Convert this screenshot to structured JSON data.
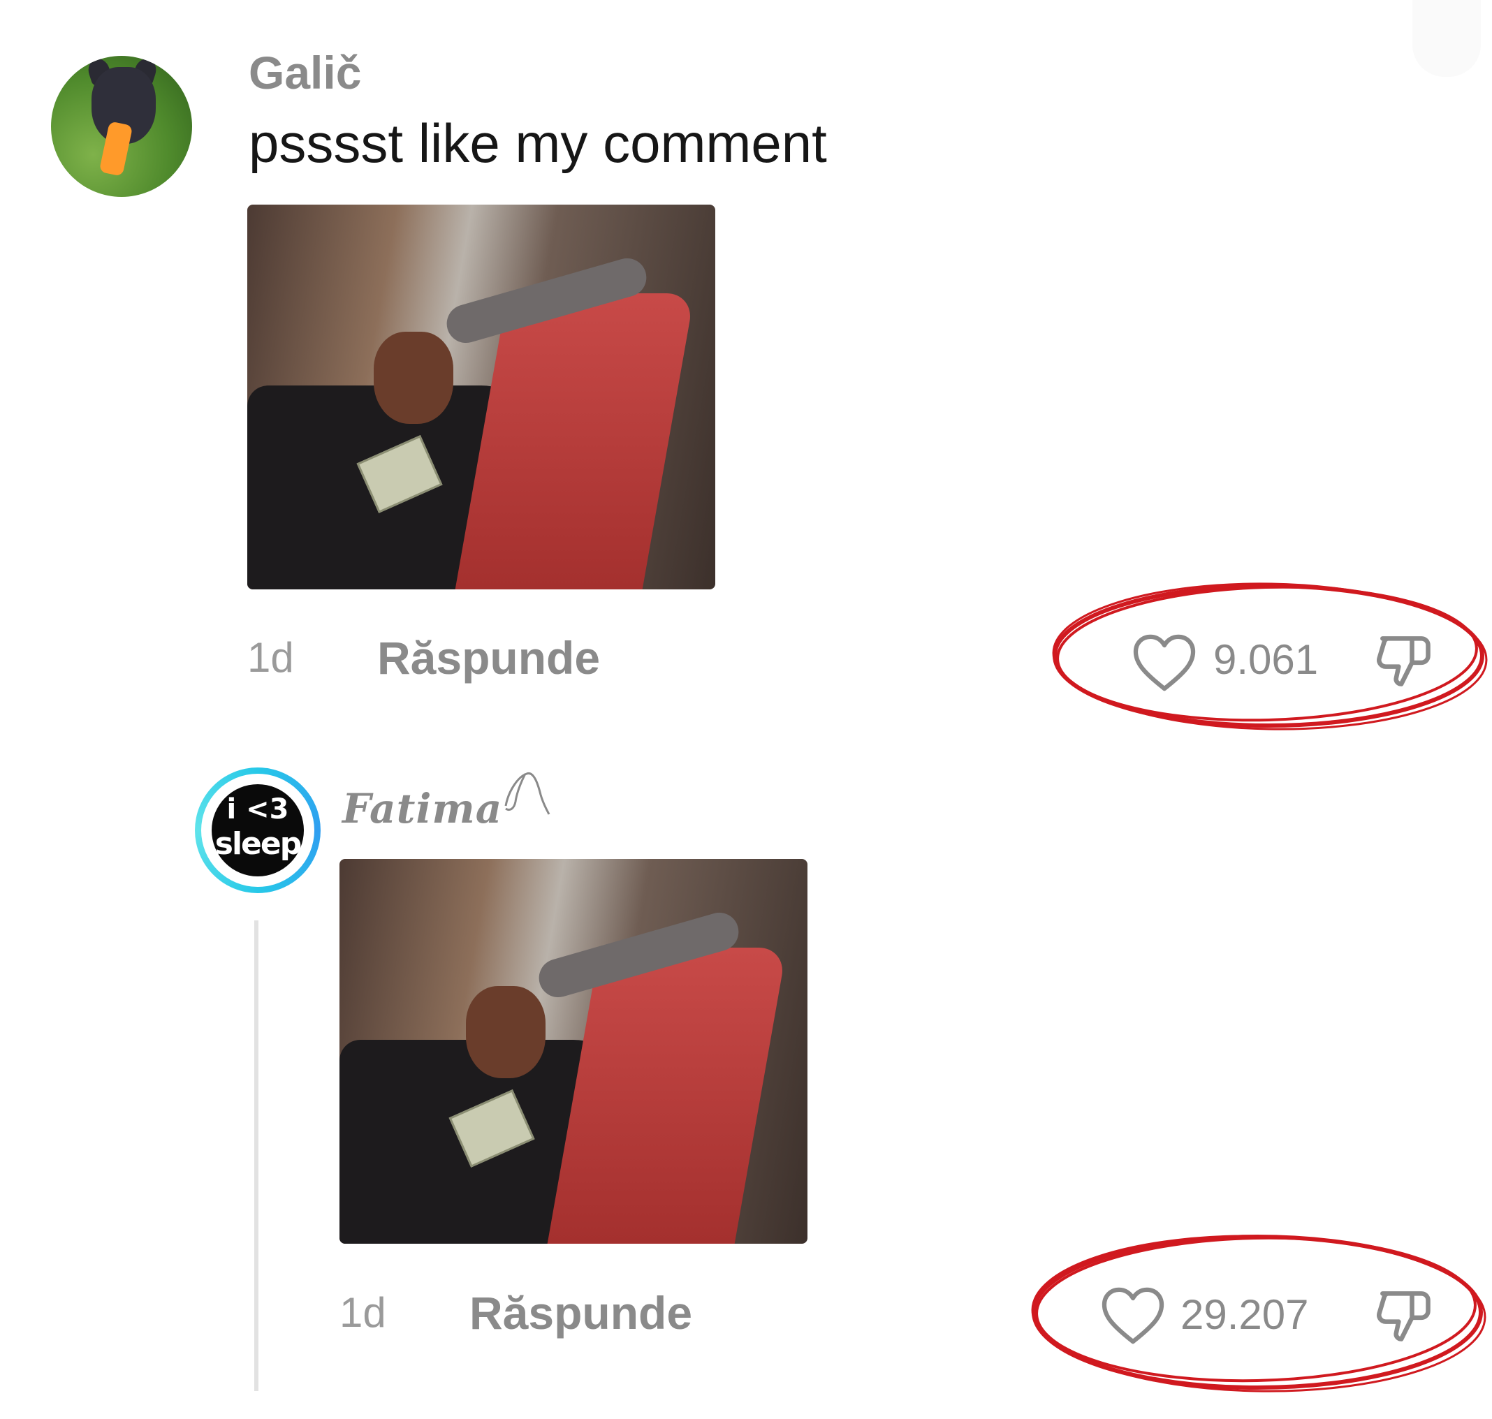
{
  "comments": [
    {
      "username": "Galič",
      "text": "psssst like my comment",
      "time": "1d",
      "reply_label": "Răspunde",
      "likes": "9.061"
    },
    {
      "username": "Fatima",
      "text": "",
      "time": "1d",
      "reply_label": "Răspunde",
      "likes": "29.207",
      "avatar_text": [
        "i <3",
        "sleep"
      ]
    }
  ],
  "icons": {
    "like": "heart-outline-icon",
    "dislike": "thumbs-down-icon"
  },
  "colors": {
    "annotation": "#d0191f",
    "muted_text": "#8a8a8a",
    "avatar_ring": "#27c8e8"
  }
}
